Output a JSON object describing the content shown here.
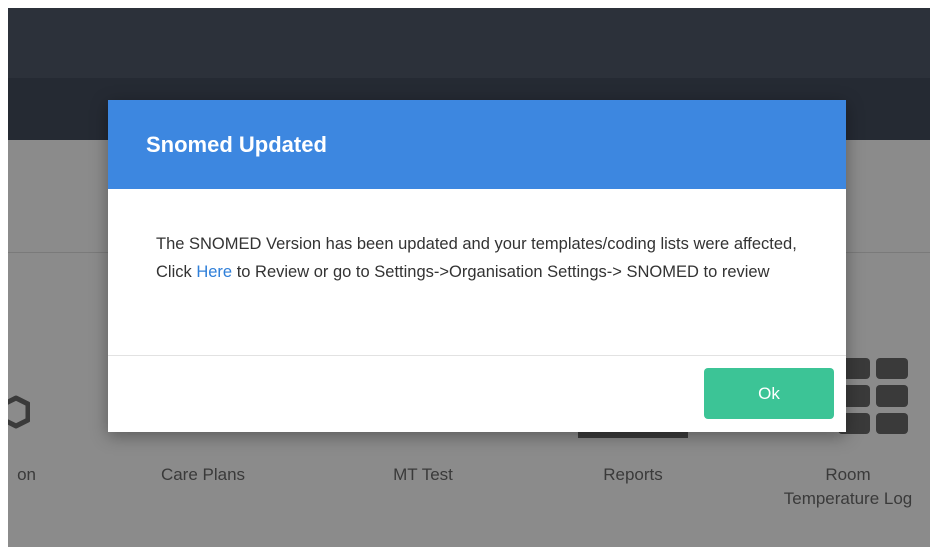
{
  "modal": {
    "title": "Snomed Updated",
    "body_part1": "The SNOMED Version has been updated and your templates/coding lists were affected, Click ",
    "link_text": "Here",
    "body_part2": " to Review or go to Settings->Organisation Settings-> SNOMED to review",
    "ok_label": "Ok"
  },
  "tiles": {
    "partial_label": "on",
    "care_plans": "Care Plans",
    "mt_test": "MT Test",
    "reports": "Reports",
    "room_line1": "Room",
    "room_line2": "Temperature Log"
  },
  "colors": {
    "header_blue": "#3d87e0",
    "ok_green": "#3cc496",
    "link_blue": "#2f7fd9",
    "topbar": "#2c313a"
  },
  "icons": {
    "partial_tile": "box-icon",
    "room_tile": "grid-icon"
  }
}
